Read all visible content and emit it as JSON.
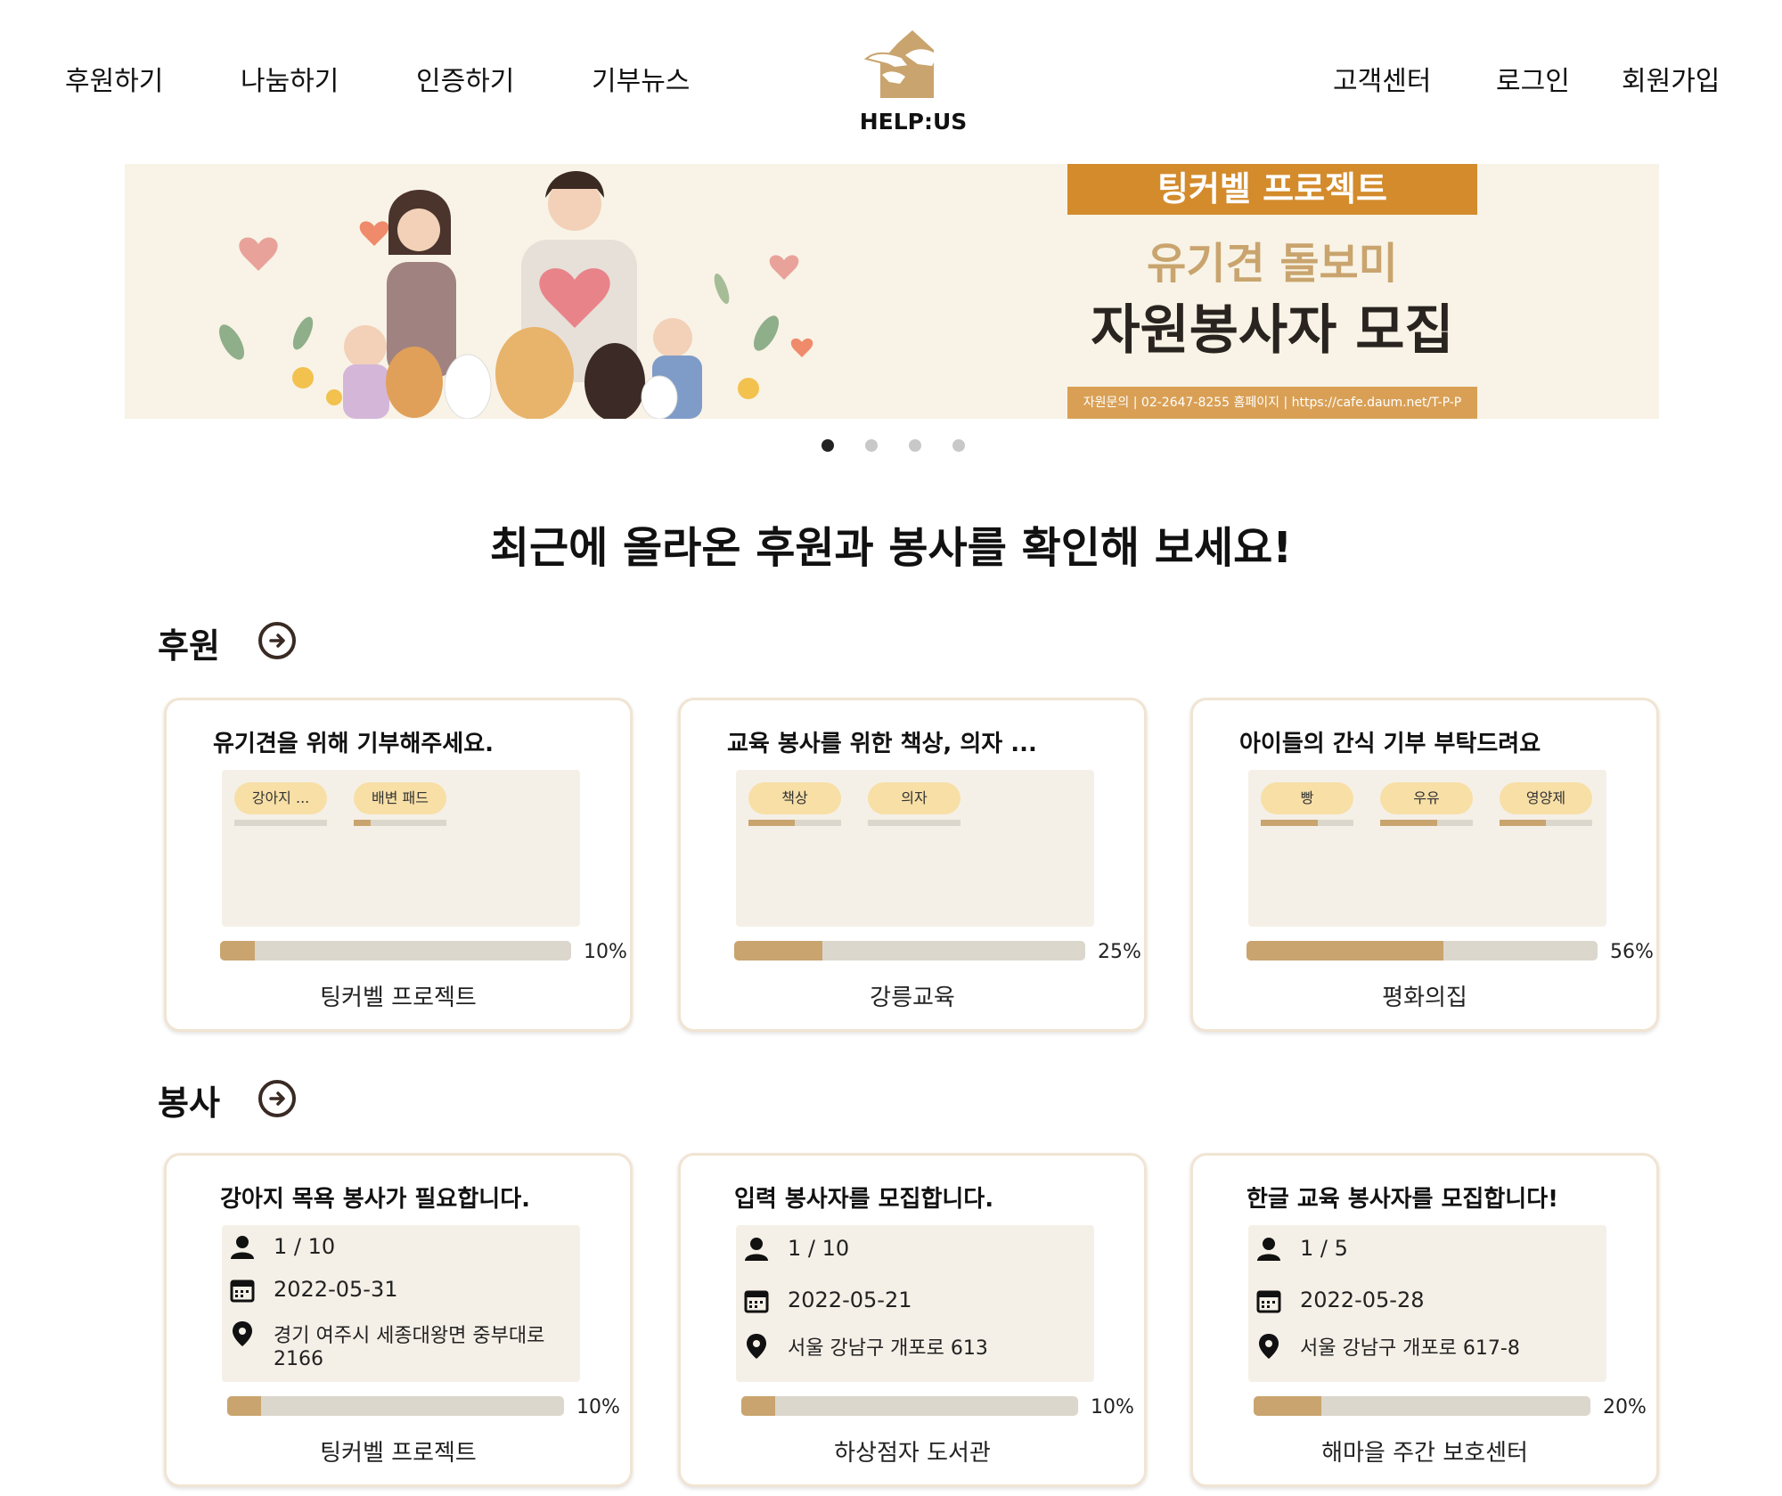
{
  "nav": {
    "left": [
      "후원하기",
      "나눔하기",
      "인증하기",
      "기부뉴스"
    ],
    "right": [
      "고객센터",
      "로그인",
      "회원가입"
    ],
    "logo_text": "HELP:US"
  },
  "banner": {
    "tag": "팅커벨 프로젝트",
    "subtitle": "유기견 돌보미",
    "title": "자원봉사자 모집",
    "footer": "자원문의 | 02-2647-8255   홈페이지 | https://cafe.daum.net/T-P-P",
    "active_slide": 1,
    "slide_count": 4
  },
  "headline": "최근에 올라온 후원과 봉사를 확인해 보세요!",
  "donation": {
    "title": "후원",
    "cards": [
      {
        "title": "유기견을 위해 기부해주세요.",
        "items": [
          {
            "label": "강아지 ...",
            "progress": 0
          },
          {
            "label": "배변 패드",
            "progress": 0.18
          }
        ],
        "progress": 10,
        "progress_label": "10%",
        "org": "팅커벨 프로젝트"
      },
      {
        "title": "교육 봉사를 위한 책상, 의자 ...",
        "items": [
          {
            "label": "책상",
            "progress": 0.5
          },
          {
            "label": "의자",
            "progress": 0
          }
        ],
        "progress": 25,
        "progress_label": "25%",
        "org": "강릉교육"
      },
      {
        "title": "아이들의 간식 기부 부탁드려요",
        "items": [
          {
            "label": "빵",
            "progress": 0.62
          },
          {
            "label": "우유",
            "progress": 0.62
          },
          {
            "label": "영양제",
            "progress": 0.5
          }
        ],
        "progress": 56,
        "progress_label": "56%",
        "org": "평화의집"
      }
    ]
  },
  "volunteer": {
    "title": "봉사",
    "cards": [
      {
        "title": "강아지 목욕 봉사가 필요합니다.",
        "people": "1 / 10",
        "date": "2022-05-31",
        "address": [
          "경기 여주시 세종대왕면 중부대로",
          "2166"
        ],
        "progress": 10,
        "progress_label": "10%",
        "org": "팅커벨 프로젝트"
      },
      {
        "title": "입력 봉사자를 모집합니다.",
        "people": "1 / 10",
        "date": "2022-05-21",
        "address": [
          "서울 강남구 개포로 613"
        ],
        "progress": 10,
        "progress_label": "10%",
        "org": "하상점자 도서관"
      },
      {
        "title": "한글 교육 봉사자를 모집합니다!",
        "people": "1 / 5",
        "date": "2022-05-28",
        "address": [
          "서울 강남구 개포로 617-8"
        ],
        "progress": 20,
        "progress_label": "20%",
        "org": "해마을 주간 보호센터"
      }
    ]
  },
  "colors": {
    "accent": "#c9a46e",
    "chip": "#f7dfa6",
    "track": "#dcd7cc",
    "box": "#f5f0e7",
    "banner_tag": "#d38b2c",
    "dark": "#3a2a24"
  }
}
